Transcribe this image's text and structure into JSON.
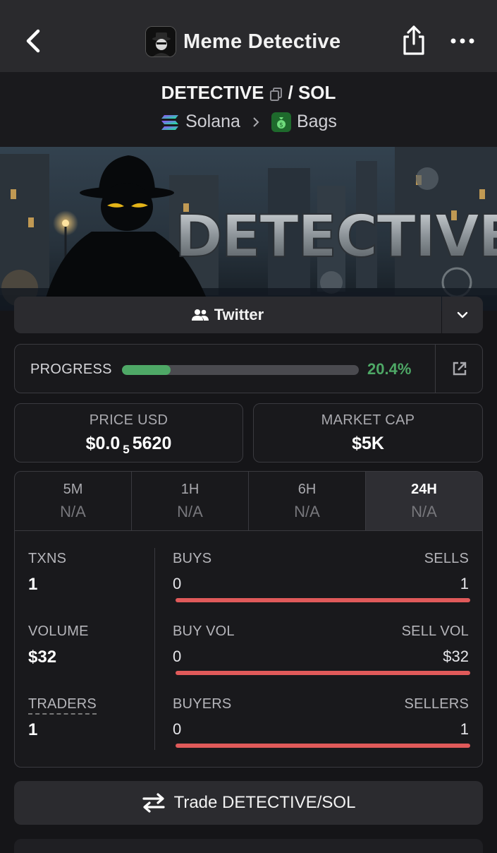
{
  "header": {
    "app_name": "Meme Detective"
  },
  "pair": {
    "base": "DETECTIVE",
    "separator": "/",
    "quote": "SOL",
    "chain": "Solana",
    "dex": "Bags"
  },
  "banner": {
    "text": "DETECTIVE"
  },
  "social": {
    "twitter_label": "Twitter"
  },
  "progress": {
    "label": "PROGRESS",
    "percent_text": "20.4%",
    "fraction": 0.204,
    "color": "#4ea866"
  },
  "stats": {
    "price_label": "PRICE USD",
    "price_prefix": "$0.0",
    "price_zeros": "5",
    "price_suffix": "5620",
    "mcap_label": "MARKET CAP",
    "mcap_value": "$5K"
  },
  "timeframes": [
    {
      "name": "5M",
      "value": "N/A"
    },
    {
      "name": "1H",
      "value": "N/A"
    },
    {
      "name": "6H",
      "value": "N/A"
    },
    {
      "name": "24H",
      "value": "N/A"
    }
  ],
  "metrics": {
    "txns_label": "TXNS",
    "txns_value": "1",
    "buys_label": "BUYS",
    "buys_value": "0",
    "sells_label": "SELLS",
    "sells_value": "1",
    "buys_fraction": 0,
    "volume_label": "VOLUME",
    "volume_value": "$32",
    "buy_vol_label": "BUY VOL",
    "buy_vol_value": "0",
    "sell_vol_label": "SELL VOL",
    "sell_vol_value": "$32",
    "buy_vol_fraction": 0,
    "traders_label": "TRADERS",
    "traders_value": "1",
    "buyers_label": "BUYERS",
    "buyers_value": "0",
    "sellers_label": "SELLERS",
    "sellers_value": "1",
    "buyers_fraction": 0
  },
  "trade": {
    "label": "Trade DETECTIVE/SOL"
  },
  "colors": {
    "buy": "#4ea866",
    "sell": "#e05a5a",
    "background": "#151518"
  },
  "icons": [
    "back-arrow-icon",
    "share-icon",
    "more-icon",
    "copy-icon",
    "solana-icon",
    "chevron-right-icon",
    "money-bag-icon",
    "users-icon",
    "chevron-down-icon",
    "external-link-icon",
    "swap-icon"
  ]
}
